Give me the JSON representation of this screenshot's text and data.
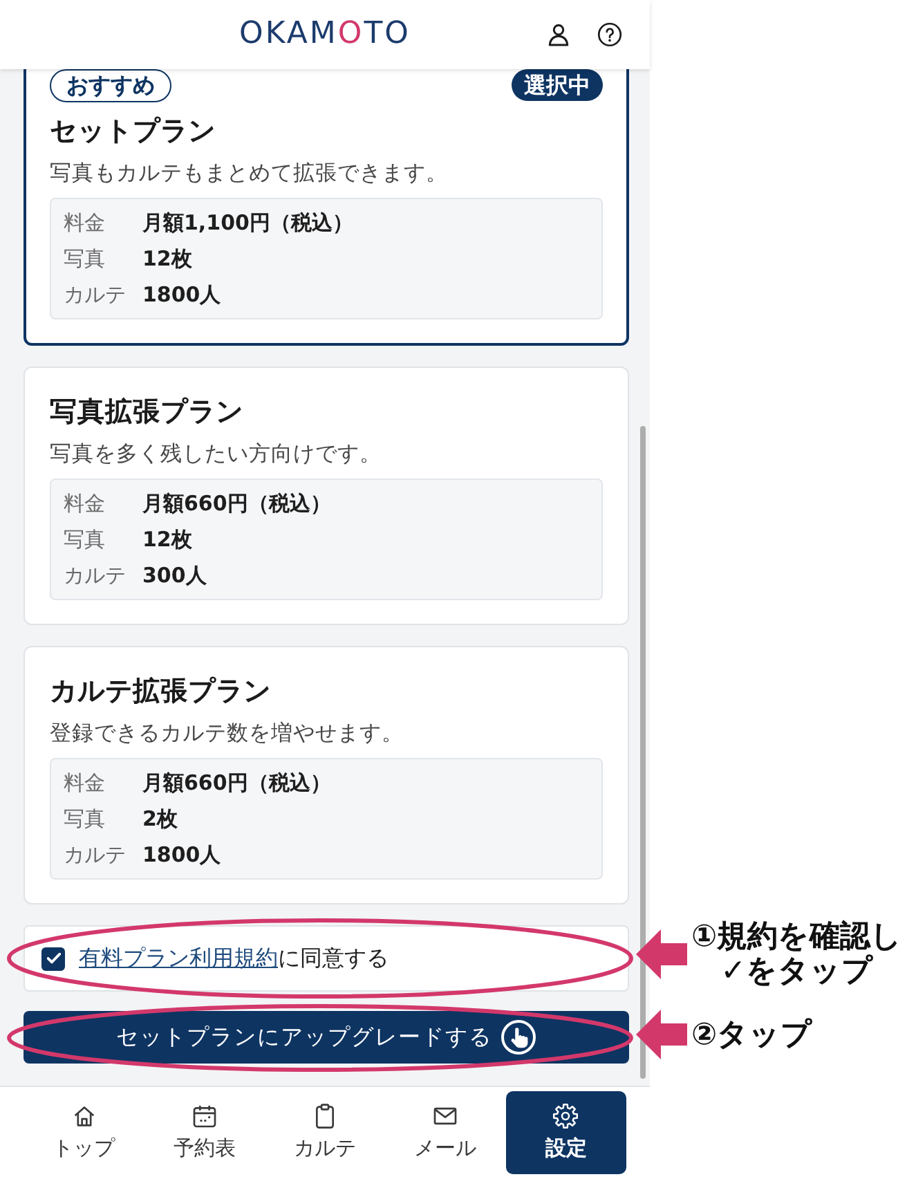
{
  "header": {
    "logo": {
      "prefix": "OKAM",
      "emblem": "O",
      "suffix": "TO"
    }
  },
  "plans": [
    {
      "badge": "おすすめ",
      "status": "選択中",
      "selected": true,
      "title": "セットプラン",
      "description": "写真もカルテもまとめて拡張できます。",
      "details": [
        {
          "label": "料金",
          "value": "月額1,100円（税込）"
        },
        {
          "label": "写真",
          "value": "12枚"
        },
        {
          "label": "カルテ",
          "value": "1800人"
        }
      ]
    },
    {
      "selected": false,
      "title": "写真拡張プラン",
      "description": "写真を多く残したい方向けです。",
      "details": [
        {
          "label": "料金",
          "value": "月額660円（税込）"
        },
        {
          "label": "写真",
          "value": "12枚"
        },
        {
          "label": "カルテ",
          "value": "300人"
        }
      ]
    },
    {
      "selected": false,
      "title": "カルテ拡張プラン",
      "description": "登録できるカルテ数を増やせます。",
      "details": [
        {
          "label": "料金",
          "value": "月額660円（税込）"
        },
        {
          "label": "写真",
          "value": "2枚"
        },
        {
          "label": "カルテ",
          "value": "1800人"
        }
      ]
    }
  ],
  "agreement": {
    "checked": true,
    "link": "有料プラン利用規約",
    "text": "に同意する"
  },
  "upgrade_button": {
    "label": "セットプランにアップグレードする"
  },
  "bottom_nav": [
    {
      "label": "トップ",
      "selected": false
    },
    {
      "label": "予約表",
      "selected": false
    },
    {
      "label": "カルテ",
      "selected": false
    },
    {
      "label": "メール",
      "selected": false
    },
    {
      "label": "設定",
      "selected": true
    }
  ],
  "annotations": [
    {
      "lines": [
        "①規約を確認し",
        "✓をタップ"
      ]
    },
    {
      "lines": [
        "②タップ"
      ]
    }
  ]
}
